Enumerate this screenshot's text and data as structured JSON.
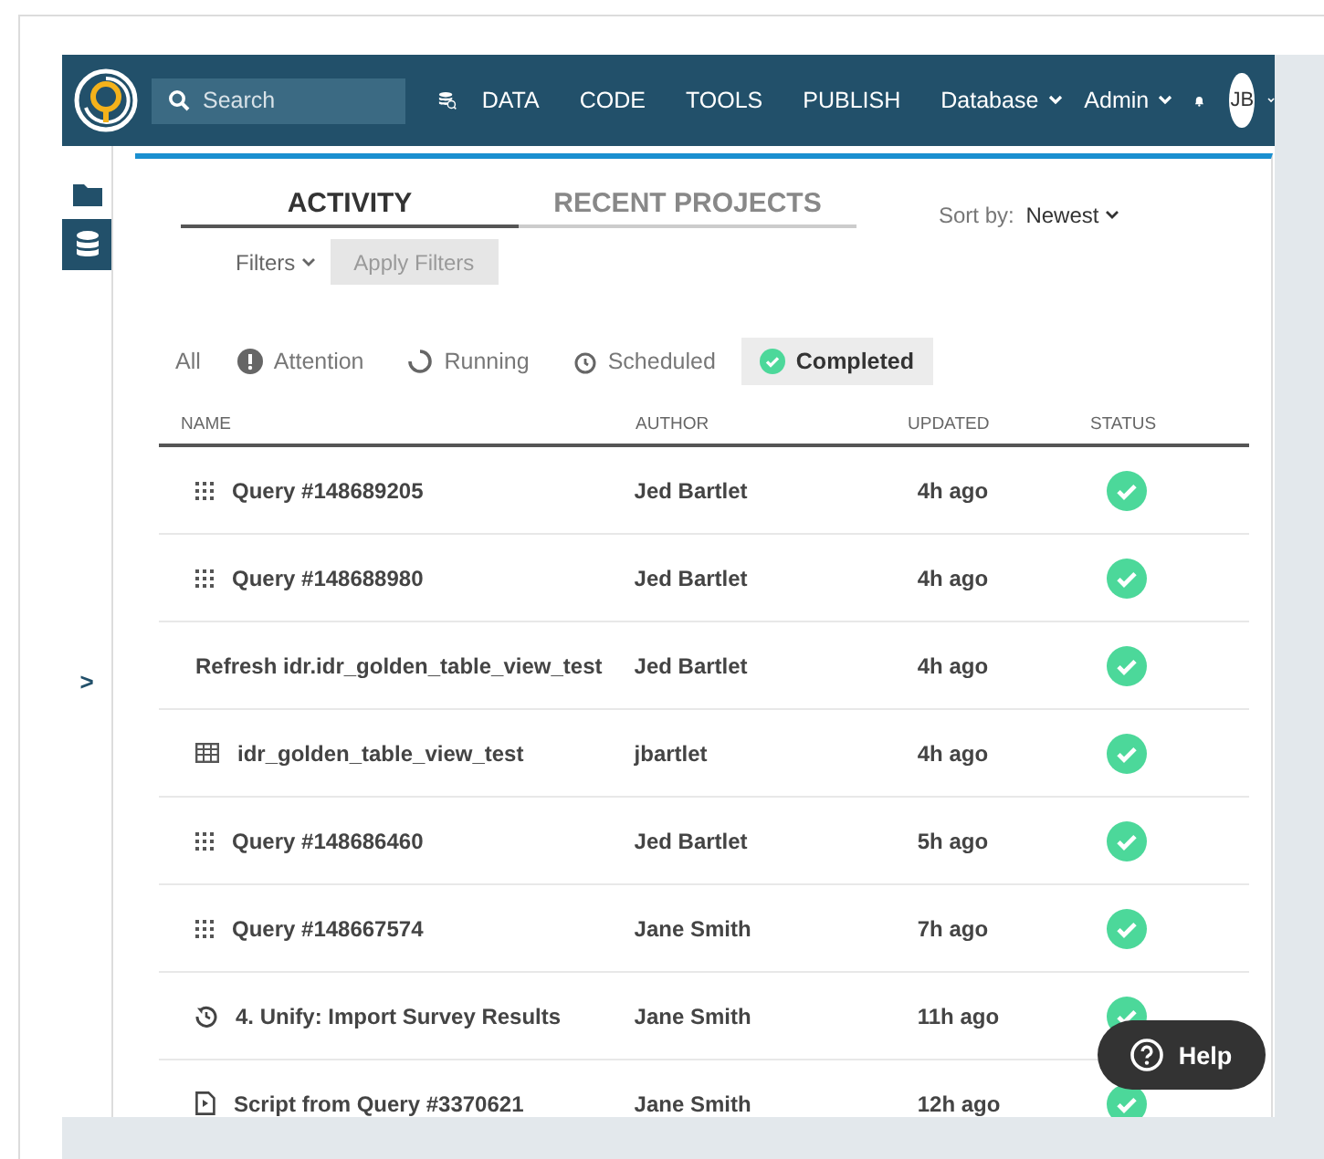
{
  "nav": {
    "search": {
      "placeholder": "Search"
    },
    "links": [
      {
        "label": "DATA"
      },
      {
        "label": "CODE"
      },
      {
        "label": "TOOLS"
      },
      {
        "label": "PUBLISH"
      }
    ],
    "menus": [
      {
        "label": "Database"
      },
      {
        "label": "Admin"
      }
    ],
    "avatar": "JB"
  },
  "sidebar": {
    "items": [
      {
        "kind": "folder",
        "selected": false
      },
      {
        "kind": "database",
        "selected": true
      }
    ],
    "expand": ">"
  },
  "tabs": [
    {
      "label": "ACTIVITY",
      "selected": true
    },
    {
      "label": "RECENT PROJECTS",
      "selected": false
    }
  ],
  "sort": {
    "label": "Sort by:",
    "value": "Newest"
  },
  "filters": {
    "label": "Filters",
    "apply": "Apply Filters",
    "apply_disabled": true
  },
  "status_filters": [
    {
      "kind": "all",
      "label": "All",
      "selected": false
    },
    {
      "kind": "attention",
      "label": "Attention",
      "selected": false
    },
    {
      "kind": "running",
      "label": "Running",
      "selected": false
    },
    {
      "kind": "scheduled",
      "label": "Scheduled",
      "selected": false
    },
    {
      "kind": "completed",
      "label": "Completed",
      "selected": true
    }
  ],
  "table": {
    "columns": [
      "NAME",
      "AUTHOR",
      "UPDATED",
      "STATUS"
    ],
    "rows": [
      {
        "kind": "query",
        "name": "Query #148689205",
        "author": "Jed Bartlet",
        "updated": "4h ago",
        "completed": true
      },
      {
        "kind": "query",
        "name": "Query #148688980",
        "author": "Jed Bartlet",
        "updated": "4h ago",
        "completed": true
      },
      {
        "kind": "refresh",
        "name": "Refresh idr.idr_golden_table_view_test",
        "author": "Jed Bartlet",
        "updated": "4h ago",
        "completed": true
      },
      {
        "kind": "table",
        "name": "idr_golden_table_view_test",
        "author": "jbartlet",
        "updated": "4h ago",
        "completed": true
      },
      {
        "kind": "query",
        "name": "Query #148686460",
        "author": "Jed Bartlet",
        "updated": "5h ago",
        "completed": true
      },
      {
        "kind": "query",
        "name": "Query #148667574",
        "author": "Jane Smith",
        "updated": "7h ago",
        "completed": true
      },
      {
        "kind": "workflow",
        "name": "4. Unify: Import Survey Results",
        "author": "Jane Smith",
        "updated": "11h ago",
        "completed": true
      },
      {
        "kind": "script",
        "name": "Script from Query #3370621",
        "author": "Jane Smith",
        "updated": "12h ago",
        "completed": true
      }
    ]
  },
  "help": "Help"
}
